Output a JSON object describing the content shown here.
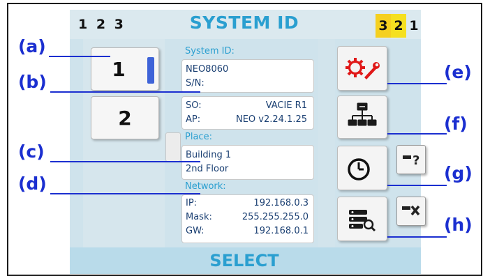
{
  "header": {
    "title": "SYSTEM ID",
    "left_indicators": "1 2 3",
    "right_indicators": [
      "3",
      "2",
      "1"
    ]
  },
  "footer": {
    "select_label": "SELECT"
  },
  "slots": [
    {
      "label": "1",
      "active": true
    },
    {
      "label": "2",
      "active": false
    }
  ],
  "system": {
    "section_label": "System ID:",
    "id_value": "NEO8060",
    "sn_label": "S/N:",
    "sn_value": "",
    "so_label": "SO:",
    "so_value": "VACIE R1",
    "ap_label": "AP:",
    "ap_value": "NEO v2.24.1.25"
  },
  "place": {
    "section_label": "Place:",
    "line1": "Building 1",
    "line2": "2nd Floor"
  },
  "network": {
    "section_label": "Network:",
    "ip_label": "IP:",
    "ip_value": "192.168.0.3",
    "mask_label": "Mask:",
    "mask_value": "255.255.255.0",
    "gw_label": "GW:",
    "gw_value": "192.168.0.1"
  },
  "actions": [
    {
      "name": "settings",
      "icon": "gear-wrench-icon"
    },
    {
      "name": "network-topology",
      "icon": "network-tree-icon"
    },
    {
      "name": "clock",
      "icon": "clock-icon"
    },
    {
      "name": "server-search",
      "icon": "server-search-icon"
    }
  ],
  "mini_actions": [
    {
      "name": "key-help",
      "icon": "key-question-icon"
    },
    {
      "name": "key-delete",
      "icon": "key-x-icon"
    }
  ],
  "annotations": {
    "a": "(a)",
    "b": "(b)",
    "c": "(c)",
    "d": "(d)",
    "e": "(e)",
    "f": "(f)",
    "g": "(g)",
    "h": "(h)"
  },
  "colors": {
    "title_blue": "#2a9fd0",
    "value_navy": "#1a3f72",
    "annotation_blue": "#1b2fd0",
    "indicator_yellow": "#f5d020",
    "slot_indicator": "#3e63d8",
    "settings_red": "#e01818"
  }
}
